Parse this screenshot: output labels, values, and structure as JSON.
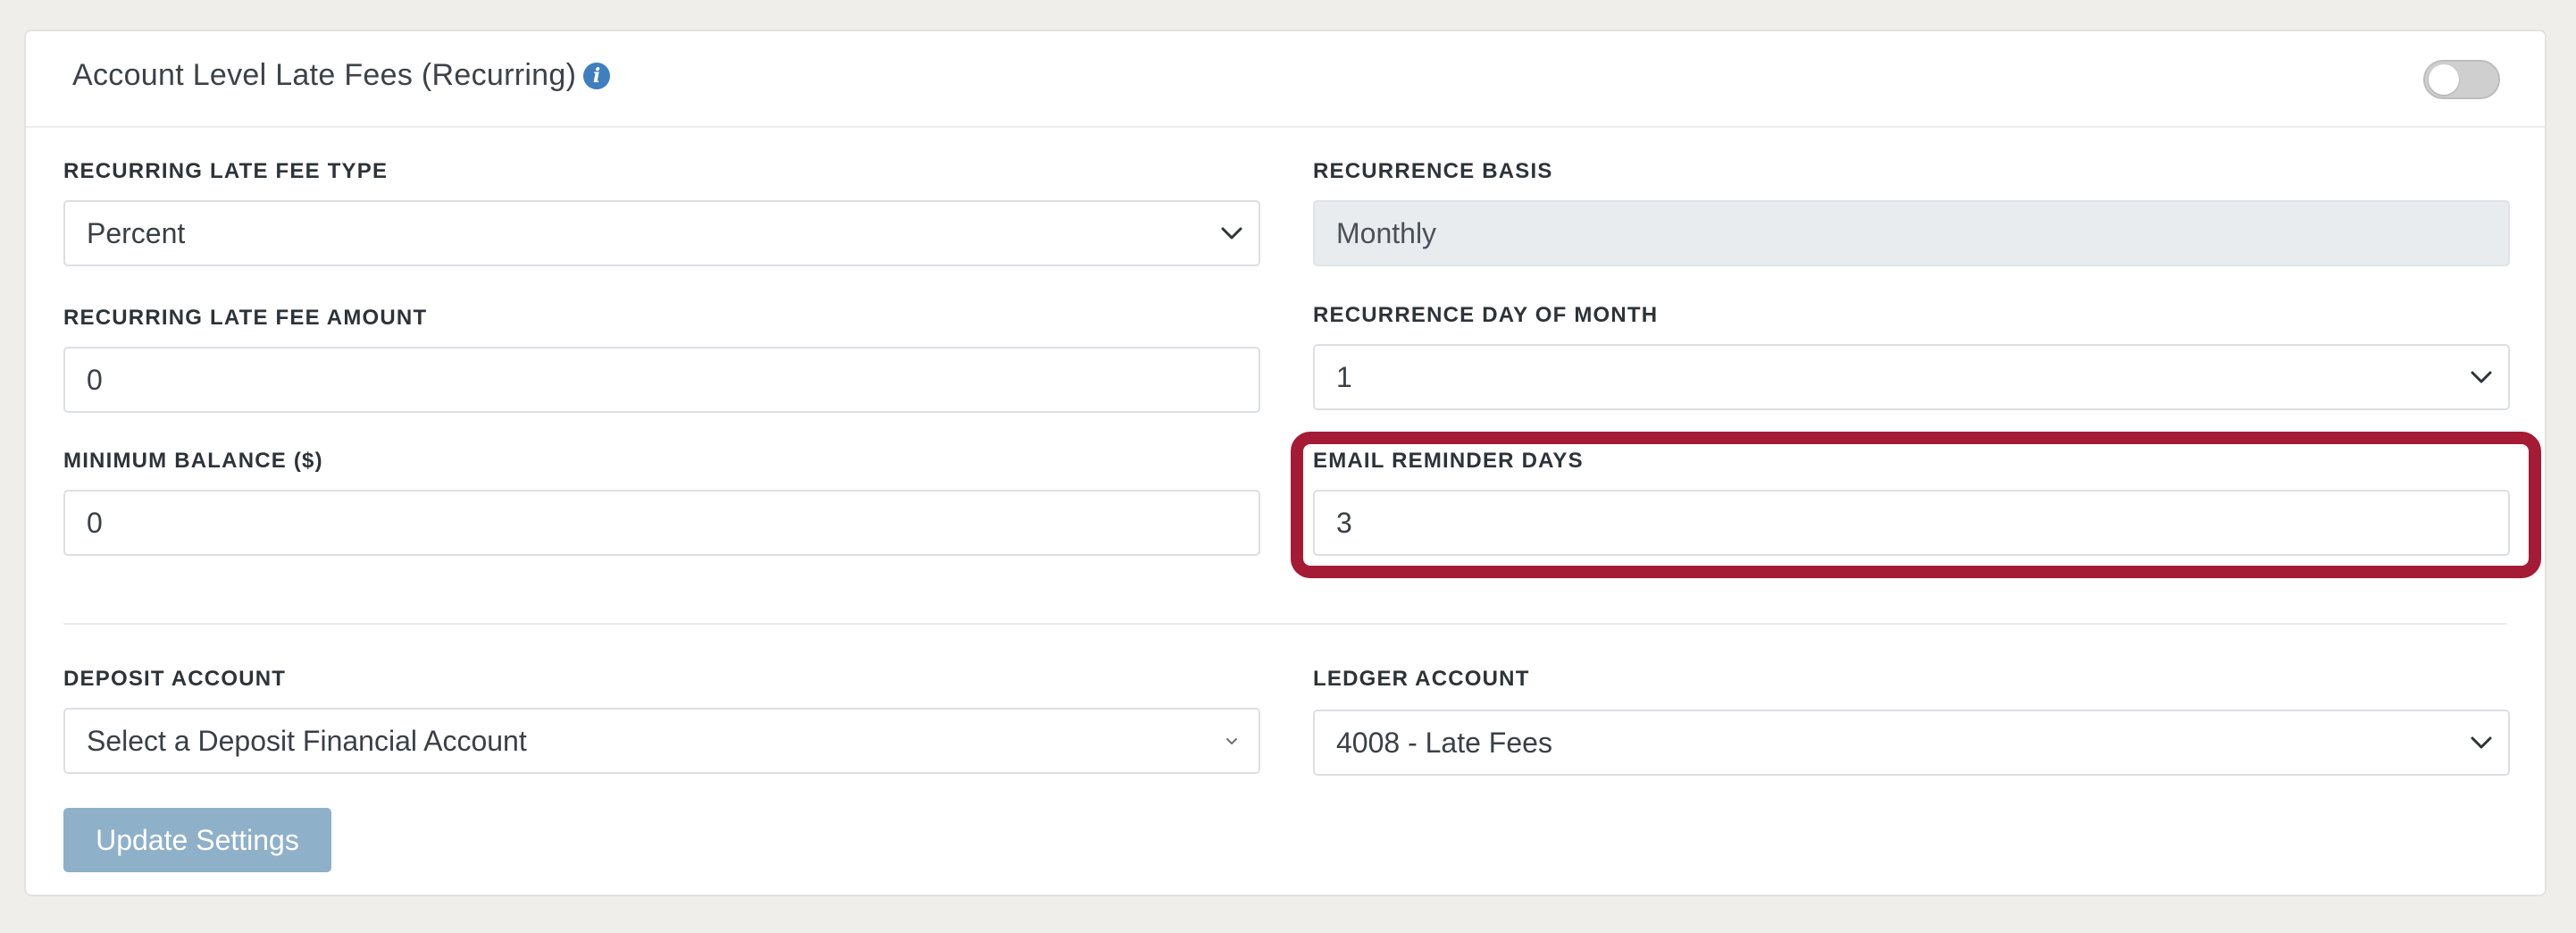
{
  "card": {
    "title": "Account Level Late Fees (Recurring)",
    "info_icon": "info-circle-icon",
    "toggle_on": false
  },
  "fields": {
    "recurring_late_fee_type": {
      "label": "RECURRING LATE FEE TYPE",
      "value": "Percent"
    },
    "recurrence_basis": {
      "label": "RECURRENCE BASIS",
      "value": "Monthly"
    },
    "recurring_late_fee_amount": {
      "label": "RECURRING LATE FEE AMOUNT",
      "value": "0"
    },
    "recurrence_day_of_month": {
      "label": "RECURRENCE DAY OF MONTH",
      "value": "1"
    },
    "minimum_balance": {
      "label": "MINIMUM BALANCE ($)",
      "value": "0"
    },
    "email_reminder_days": {
      "label": "EMAIL REMINDER DAYS",
      "value": "3"
    },
    "deposit_account": {
      "label": "DEPOSIT ACCOUNT",
      "placeholder": "Select a Deposit Financial Account"
    },
    "ledger_account": {
      "label": "LEDGER ACCOUNT",
      "value": "4008 - Late Fees"
    }
  },
  "actions": {
    "update_label": "Update Settings"
  },
  "colors": {
    "highlight": "#a51a35",
    "button": "#8fb0c9",
    "info_icon": "#3f7fbf"
  }
}
